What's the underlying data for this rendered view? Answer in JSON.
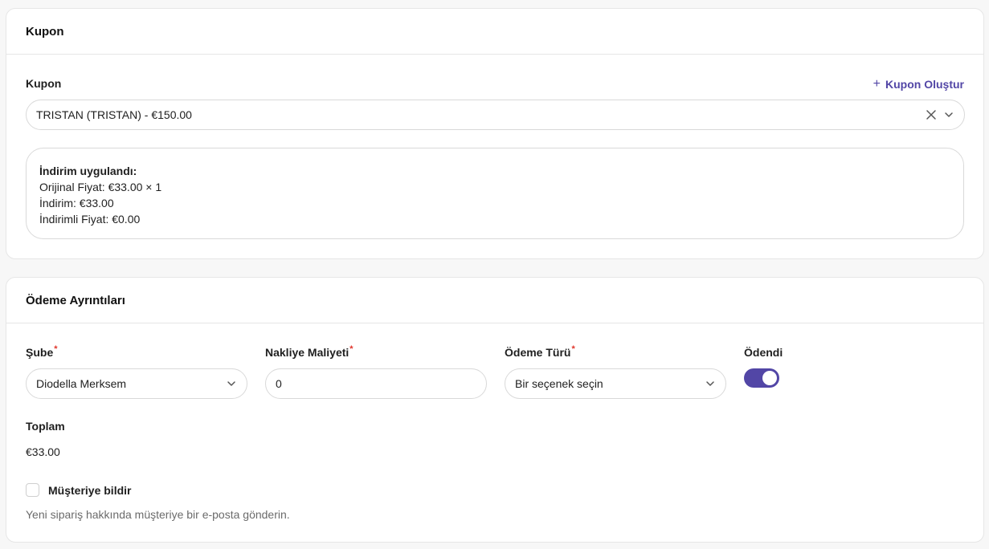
{
  "coupon_section": {
    "title": "Kupon",
    "field_label": "Kupon",
    "create_link_label": "Kupon Oluştur",
    "selected_value": "TRISTAN (TRISTAN) - €150.00",
    "discount_info": {
      "title": "İndirim uygulandı:",
      "original_price": "Orijinal Fiyat: €33.00 × 1",
      "discount": "İndirim: €33.00",
      "discounted_price": "İndirimli Fiyat: €0.00"
    }
  },
  "payment_section": {
    "title": "Ödeme Ayrıntıları",
    "branch": {
      "label": "Şube",
      "required_mark": "*",
      "value": "Diodella Merksem"
    },
    "shipping_cost": {
      "label": "Nakliye Maliyeti",
      "required_mark": "*",
      "value": "0"
    },
    "payment_type": {
      "label": "Ödeme Türü",
      "required_mark": "*",
      "placeholder": "Bir seçenek seçin"
    },
    "paid": {
      "label": "Ödendi",
      "checked": true
    },
    "total": {
      "label": "Toplam",
      "value": "€33.00"
    },
    "notify_customer": {
      "label": "Müşteriye bildir",
      "checked": false,
      "helper": "Yeni sipariş hakkında müşteriye bir e-posta gönderin."
    }
  },
  "colors": {
    "accent": "#5246a6",
    "required": "#e0352b",
    "border": "#d9d9d9",
    "muted_text": "#6b6b6b"
  },
  "icons": {
    "clear": "close-icon",
    "dropdown": "chevron-down-icon",
    "add": "plus-icon"
  }
}
